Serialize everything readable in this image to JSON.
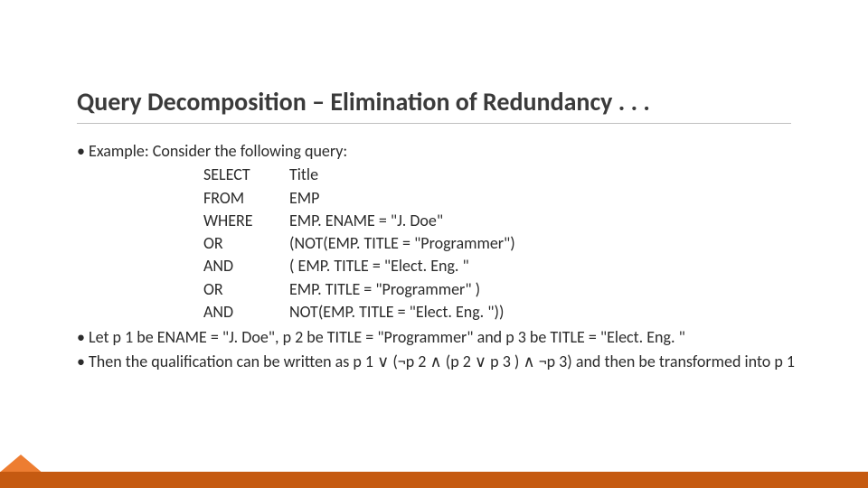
{
  "slide": {
    "title": "Query Decomposition – Elimination of Redundancy . . .",
    "bullet1": "• Example: Consider the following query:",
    "query": {
      "rows": [
        {
          "kw": "SELECT",
          "val": "Title"
        },
        {
          "kw": "FROM",
          "val": "EMP"
        },
        {
          "kw": "WHERE",
          "val": "EMP. ENAME = \"J. Doe\""
        },
        {
          "kw": "OR",
          "val": "(NOT(EMP. TITLE = \"Programmer\")"
        },
        {
          "kw": "AND",
          "val": "( EMP. TITLE = \"Elect. Eng. \""
        },
        {
          "kw": "OR",
          "val": " EMP. TITLE = \"Programmer\" )"
        },
        {
          "kw": "AND",
          "val": " NOT(EMP. TITLE = \"Elect. Eng. \"))"
        }
      ]
    },
    "bullet2": "• Let p 1 be ENAME = \"J. Doe\", p 2 be TITLE = \"Programmer\" and p 3 be TITLE = \"Elect. Eng. \"",
    "bullet3_pre": " • Then the qualification can be written as p 1 ",
    "or1": "∨",
    "bullet3_mid1": " (¬p 2 ",
    "and1": "∧",
    "bullet3_mid2": " (p 2 ",
    "or2": "∨",
    "bullet3_mid3": " p 3 ) ",
    "and2": "∧",
    "bullet3_mid4": " ¬p 3) and then be transformed    into p 1"
  }
}
